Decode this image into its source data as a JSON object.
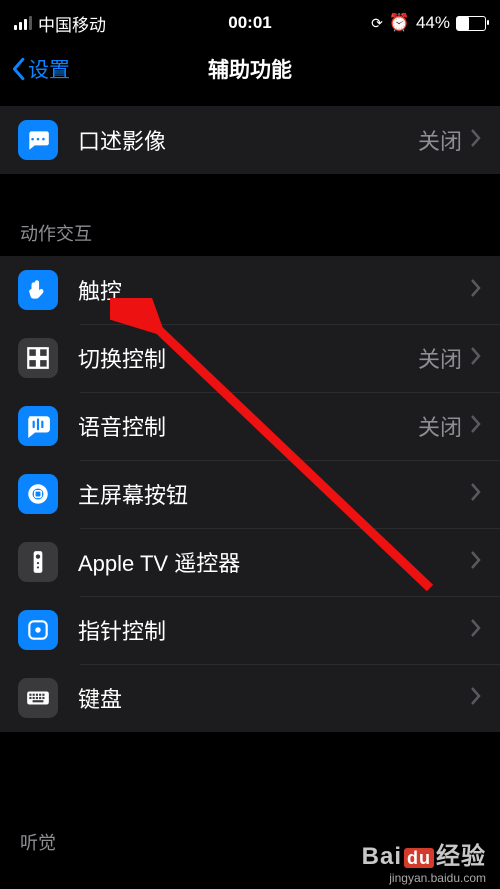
{
  "status": {
    "carrier": "中国移动",
    "time": "00:01",
    "battery_pct": "44%"
  },
  "nav": {
    "back": "设置",
    "title": "辅助功能"
  },
  "group1": {
    "items": [
      {
        "label": "口述影像",
        "value": "关闭"
      }
    ]
  },
  "group2": {
    "header": "动作交互",
    "items": [
      {
        "label": "触控",
        "value": ""
      },
      {
        "label": "切换控制",
        "value": "关闭"
      },
      {
        "label": "语音控制",
        "value": "关闭"
      },
      {
        "label": "主屏幕按钮",
        "value": ""
      },
      {
        "label": "Apple TV 遥控器",
        "value": ""
      },
      {
        "label": "指针控制",
        "value": ""
      },
      {
        "label": "键盘",
        "value": ""
      }
    ]
  },
  "group3": {
    "header": "听觉"
  },
  "watermark": {
    "brand_left": "Bai",
    "brand_mid": "du",
    "brand_right": "经验",
    "url": "jingyan.baidu.com"
  }
}
